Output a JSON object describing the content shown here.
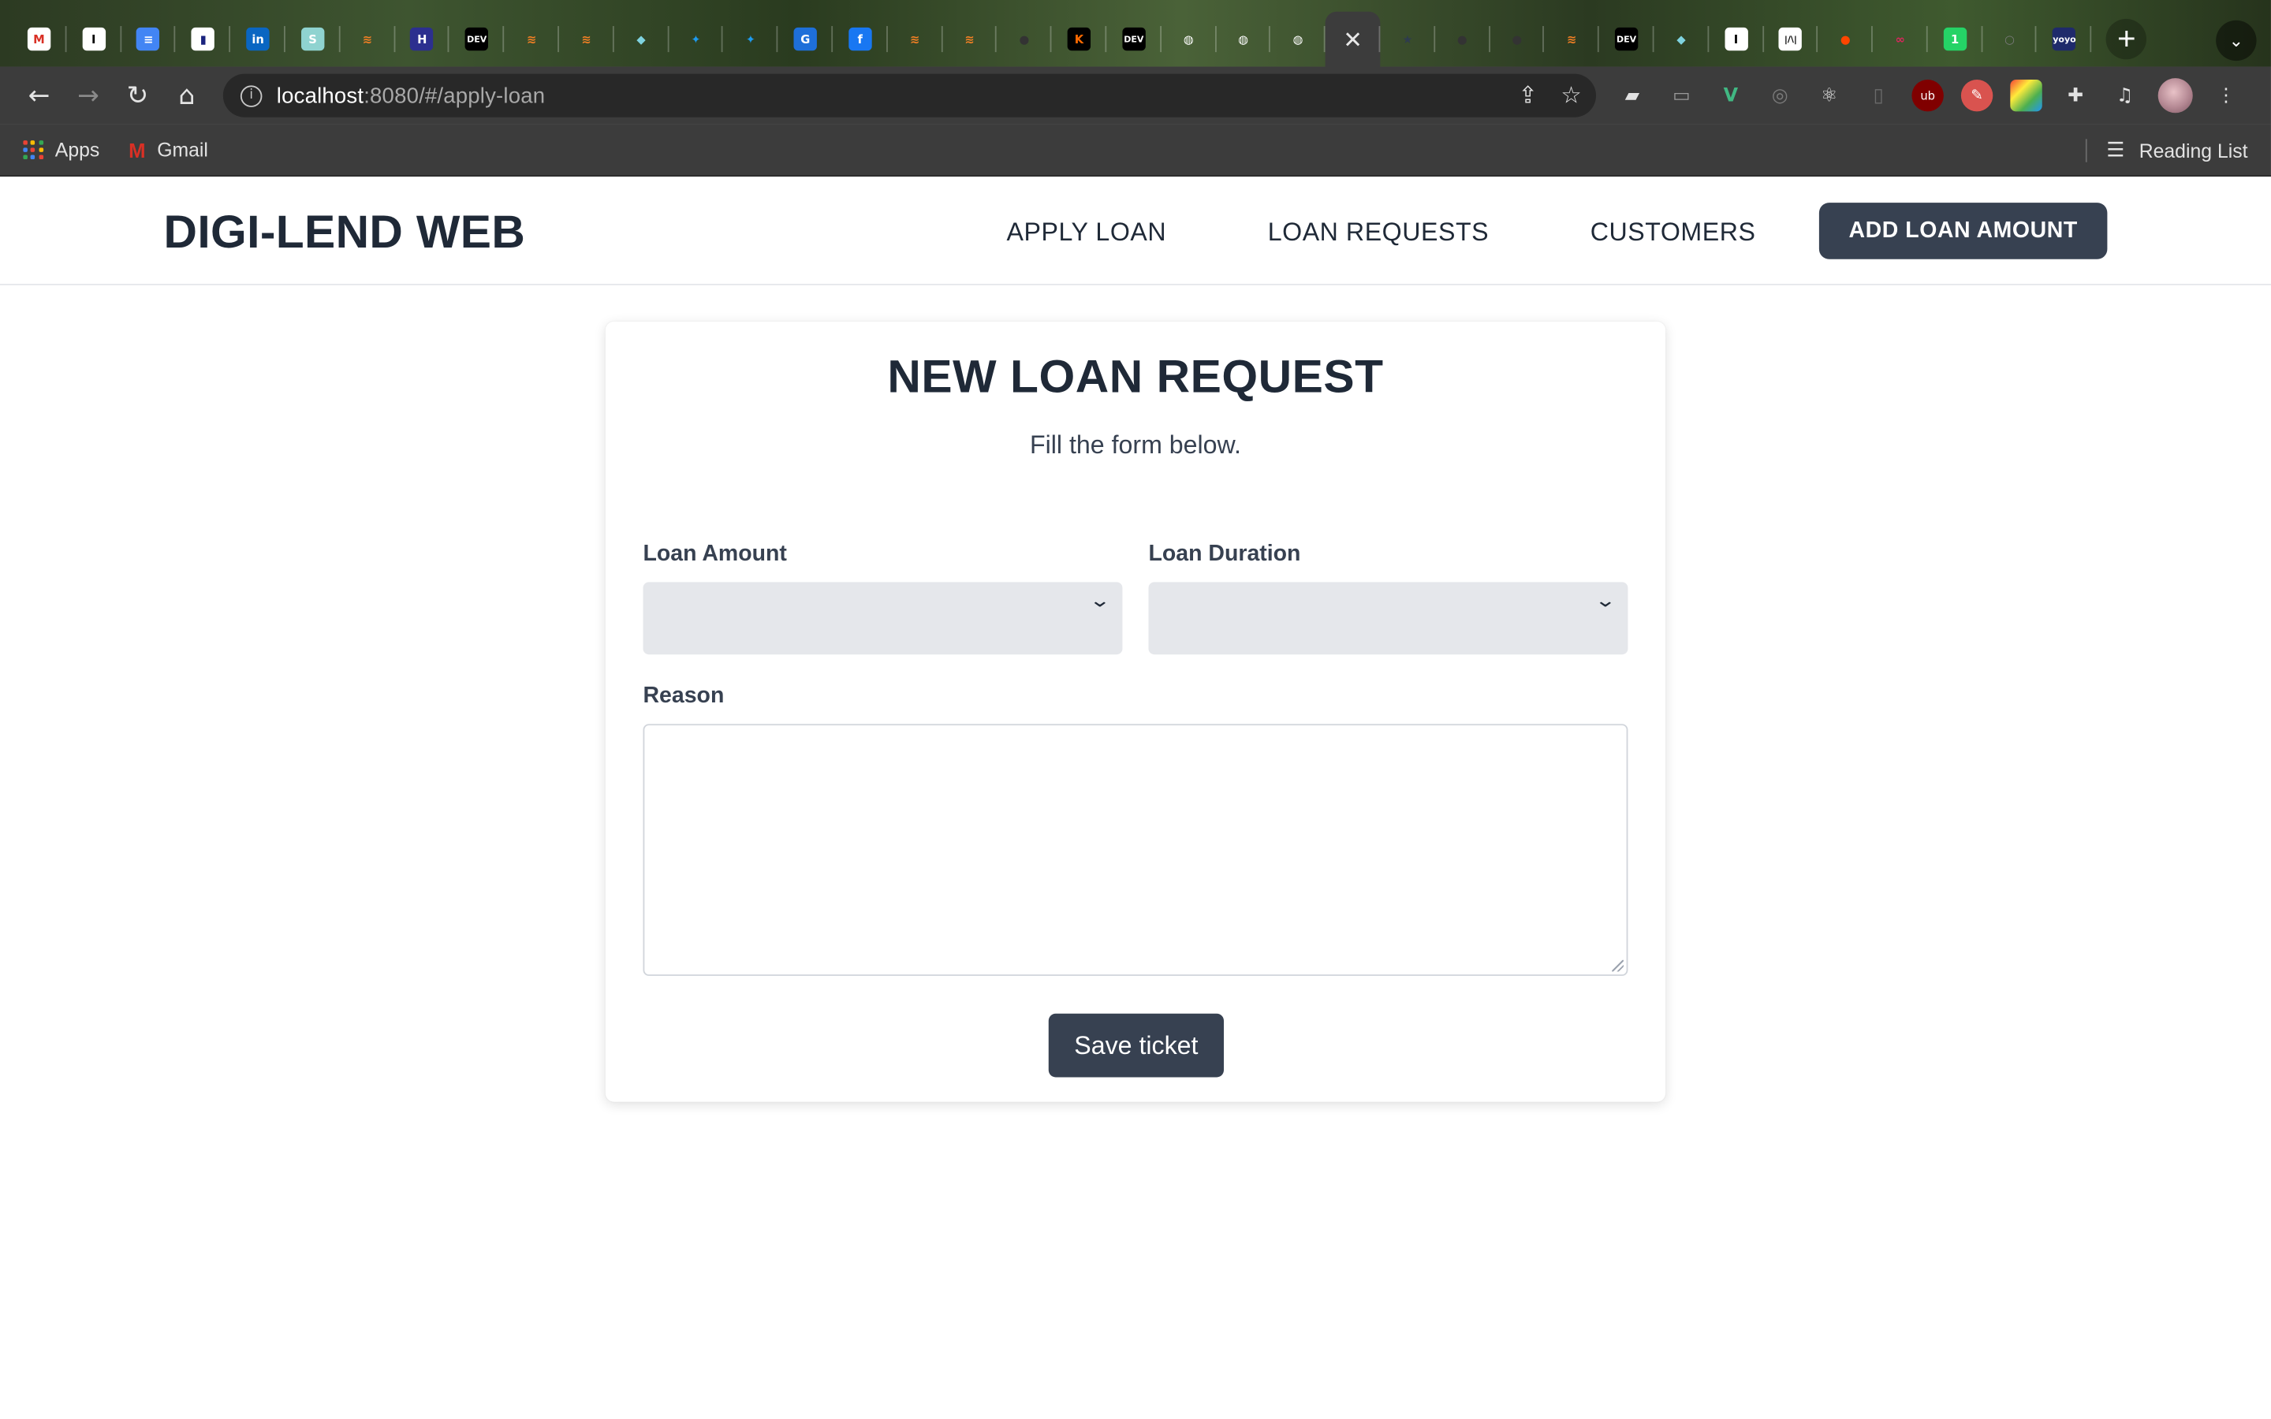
{
  "browser": {
    "tabs": [
      {
        "icon": "gmail-icon",
        "glyph": "M",
        "bg": "#ffffff",
        "fg": "#d93025"
      },
      {
        "icon": "instapaper-icon",
        "glyph": "I",
        "bg": "#ffffff",
        "fg": "#000000"
      },
      {
        "icon": "google-docs-icon",
        "glyph": "≡",
        "bg": "#4285f4",
        "fg": "#ffffff"
      },
      {
        "icon": "bookmark-app-icon",
        "glyph": "▮",
        "bg": "#ffffff",
        "fg": "#1a237e"
      },
      {
        "icon": "linkedin-icon",
        "glyph": "in",
        "bg": "#0a66c2",
        "fg": "#ffffff"
      },
      {
        "icon": "s-app-icon",
        "glyph": "S",
        "bg": "#8fd3d0",
        "fg": "#ffffff"
      },
      {
        "icon": "stackoverflow-icon",
        "glyph": "≋",
        "bg": "transparent",
        "fg": "#f48024"
      },
      {
        "icon": "hashnode-icon",
        "glyph": "H",
        "bg": "#2c2f8f",
        "fg": "#ffffff"
      },
      {
        "icon": "dev-to-icon",
        "glyph": "DEV",
        "bg": "#000000",
        "fg": "#ffffff"
      },
      {
        "icon": "stackoverflow-icon",
        "glyph": "≋",
        "bg": "transparent",
        "fg": "#f48024"
      },
      {
        "icon": "stackoverflow-icon",
        "glyph": "≋",
        "bg": "transparent",
        "fg": "#f48024"
      },
      {
        "icon": "cube-icon",
        "glyph": "◆",
        "bg": "transparent",
        "fg": "#7fd3e0"
      },
      {
        "icon": "twitter-icon",
        "glyph": "✦",
        "bg": "transparent",
        "fg": "#1d9bf0"
      },
      {
        "icon": "twitter-icon",
        "glyph": "✦",
        "bg": "transparent",
        "fg": "#1d9bf0"
      },
      {
        "icon": "grammarly-icon",
        "glyph": "G",
        "bg": "#1e6fd9",
        "fg": "#ffffff"
      },
      {
        "icon": "facebook-icon",
        "glyph": "f",
        "bg": "#1877f2",
        "fg": "#ffffff"
      },
      {
        "icon": "stackoverflow-icon",
        "glyph": "≋",
        "bg": "transparent",
        "fg": "#f48024"
      },
      {
        "icon": "stackoverflow-icon",
        "glyph": "≋",
        "bg": "transparent",
        "fg": "#f48024"
      },
      {
        "icon": "github-icon",
        "glyph": "●",
        "bg": "transparent",
        "fg": "#333333"
      },
      {
        "icon": "k-app-icon",
        "glyph": "K",
        "bg": "#000000",
        "fg": "#ff6a00"
      },
      {
        "icon": "dev-to-icon",
        "glyph": "DEV",
        "bg": "#000000",
        "fg": "#ffffff"
      },
      {
        "icon": "globe-icon",
        "glyph": "◍",
        "bg": "transparent",
        "fg": "#ffffff"
      },
      {
        "icon": "globe-icon",
        "glyph": "◍",
        "bg": "transparent",
        "fg": "#ffffff"
      },
      {
        "icon": "globe-icon",
        "glyph": "◍",
        "bg": "transparent",
        "fg": "#ffffff"
      },
      {
        "icon": "close-icon",
        "glyph": "✕",
        "bg": "transparent",
        "fg": "#e8e8e8",
        "active": true
      },
      {
        "icon": "star-app-icon",
        "glyph": "★",
        "bg": "transparent",
        "fg": "#2e3b4e"
      },
      {
        "icon": "github-icon",
        "glyph": "●",
        "bg": "transparent",
        "fg": "#333333"
      },
      {
        "icon": "github-icon",
        "glyph": "●",
        "bg": "transparent",
        "fg": "#333333"
      },
      {
        "icon": "stackoverflow-icon",
        "glyph": "≋",
        "bg": "transparent",
        "fg": "#f48024"
      },
      {
        "icon": "dev-to-icon",
        "glyph": "DEV",
        "bg": "#000000",
        "fg": "#ffffff"
      },
      {
        "icon": "cube-icon",
        "glyph": "◆",
        "bg": "transparent",
        "fg": "#7fd3e0"
      },
      {
        "icon": "instapaper-icon",
        "glyph": "I",
        "bg": "#ffffff",
        "fg": "#000000"
      },
      {
        "icon": "waveform-app-icon",
        "glyph": "|/\\|",
        "bg": "#ffffff",
        "fg": "#000000"
      },
      {
        "icon": "reddit-icon",
        "glyph": "●",
        "bg": "transparent",
        "fg": "#ff4500"
      },
      {
        "icon": "link-app-icon",
        "glyph": "∞",
        "bg": "transparent",
        "fg": "#e0245e"
      },
      {
        "icon": "whatsapp-icon",
        "glyph": "1",
        "bg": "#25d366",
        "fg": "#ffffff"
      },
      {
        "icon": "loading-icon",
        "glyph": "○",
        "bg": "transparent",
        "fg": "#7a7a7a"
      },
      {
        "icon": "yoyo-app-icon",
        "glyph": "yoyo",
        "bg": "#1f2a6b",
        "fg": "#ffffff"
      }
    ],
    "url": {
      "host": "localhost",
      "path": ":8080/#/apply-loan"
    },
    "bookmarks": {
      "apps_label": "Apps",
      "gmail_label": "Gmail",
      "reading_list_label": "Reading List"
    }
  },
  "app": {
    "brand": "DIGI-LEND WEB",
    "nav": {
      "apply_loan": "APPLY LOAN",
      "loan_requests": "LOAN REQUESTS",
      "customers": "CUSTOMERS",
      "add_loan_amount": "ADD LOAN AMOUNT"
    },
    "form": {
      "title": "NEW LOAN REQUEST",
      "subtitle": "Fill the form below.",
      "loan_amount_label": "Loan Amount",
      "loan_amount_value": "",
      "loan_duration_label": "Loan Duration",
      "loan_duration_value": "",
      "reason_label": "Reason",
      "reason_value": "",
      "save_label": "Save ticket"
    }
  },
  "colors": {
    "primary_dark": "#374151",
    "heading": "#1f2937",
    "select_bg": "#e5e7eb"
  }
}
